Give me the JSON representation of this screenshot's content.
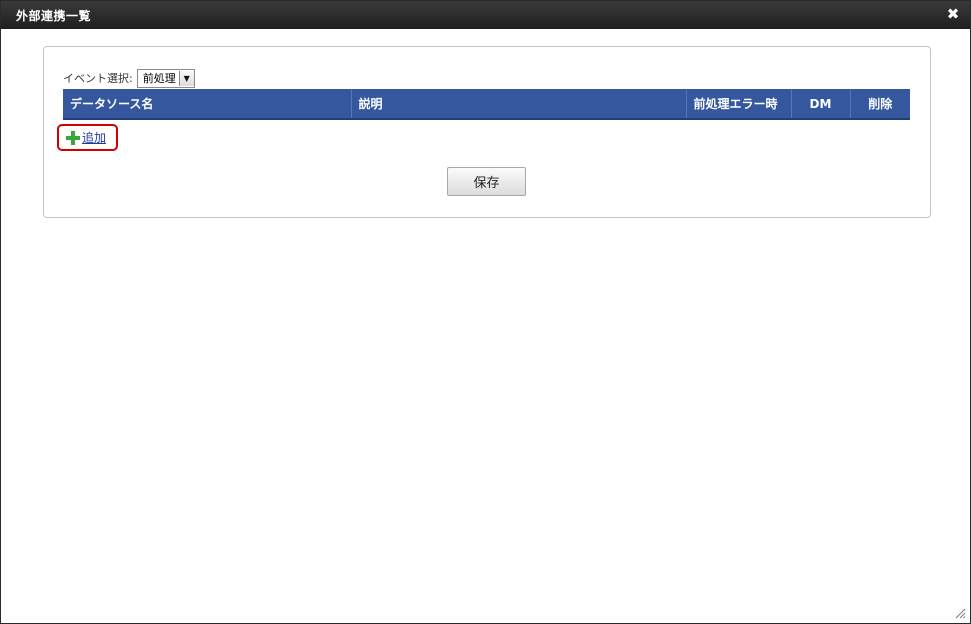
{
  "window": {
    "title": "外部連携一覧",
    "close_symbol": "✖"
  },
  "event": {
    "label": "イベント選択:",
    "selected": "前処理",
    "arrow_symbol": "▼"
  },
  "table": {
    "columns": [
      "データソース名",
      "説明",
      "前処理エラー時",
      "DM",
      "削除"
    ],
    "rows": []
  },
  "add": {
    "label": "追加",
    "icon": "plus-icon"
  },
  "save": {
    "label": "保存"
  },
  "colors": {
    "header_bg": "#34579d",
    "titlebar_bg": "#2a2a2a",
    "highlight": "#d20000",
    "plus": "#3aa53a",
    "link": "#1a3aa6"
  }
}
